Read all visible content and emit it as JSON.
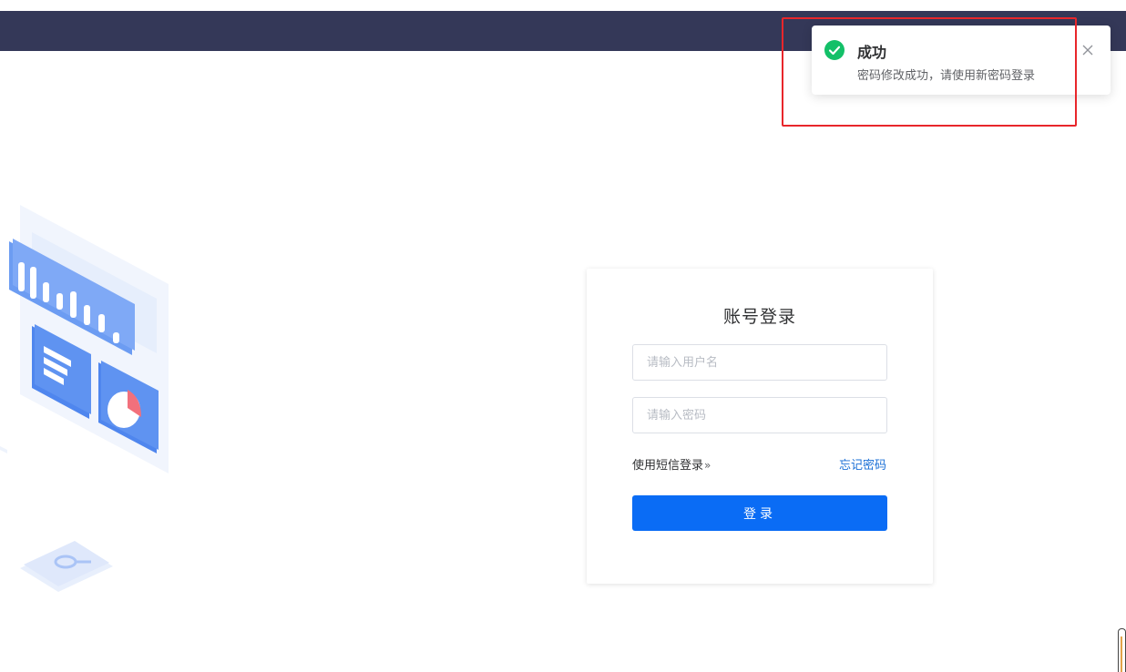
{
  "login": {
    "title": "账号登录",
    "username_placeholder": "请输入用户名",
    "username_value": "",
    "password_placeholder": "请输入密码",
    "password_value": "",
    "sms_login_label": "使用短信登录",
    "sms_arrow": "»",
    "forgot_password_label": "忘记密码",
    "submit_label": "登录"
  },
  "notification": {
    "type": "success",
    "title": "成功",
    "message": "密码修改成功，请使用新密码登录"
  },
  "colors": {
    "header": "#343858",
    "primary": "#0a6cf5",
    "success": "#13c068",
    "link": "#1a6fd6",
    "highlight": "#e8262b"
  },
  "icons": {
    "notification_status": "check-circle-icon",
    "notification_close": "close-icon",
    "sms_arrow": "double-chevron-right-icon"
  }
}
